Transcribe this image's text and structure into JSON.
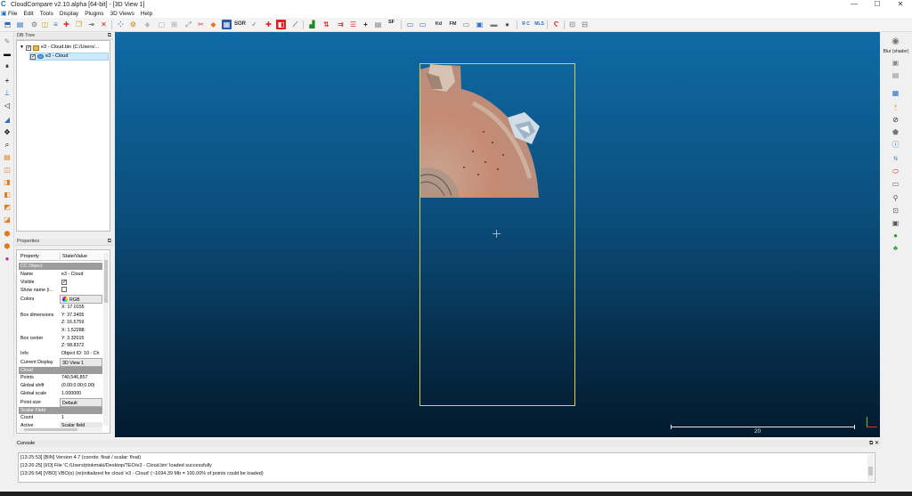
{
  "window": {
    "title": "CloudCompare v2.10.alpha [64-bit] - [3D View 1]",
    "controls": [
      "—",
      "☐",
      "✕"
    ]
  },
  "menu": [
    "File",
    "Edit",
    "Tools",
    "Display",
    "Plugins",
    "3D Views",
    "Help"
  ],
  "toolbar": {
    "sor_label": "SOR",
    "sf_label": "SF",
    "kd_label": "Kd",
    "fm_label": "FM",
    "rc_label": "R C",
    "mls_label": "MLS"
  },
  "db_tree": {
    "title": "DB Tree",
    "items": [
      {
        "label": "e3 - Cloud.bin (C:/Users/..."
      },
      {
        "label": "e3 - Cloud"
      }
    ]
  },
  "properties": {
    "title": "Properties",
    "col_property": "Property",
    "col_value": "State/Value",
    "sections": {
      "cc_object": "CC Object",
      "cloud": "Cloud",
      "scalar_field": "Scalar Field"
    },
    "rows": {
      "name_k": "Name",
      "name_v": "e3 - Cloud",
      "visible_k": "Visible",
      "visible_v": "✓",
      "showname_k": "Show name (i...",
      "showname_v": "",
      "colors_k": "Colors",
      "colors_v": "RGB",
      "boxdim_k": "Box dimensions",
      "boxdim_x": "X: 17.0155",
      "boxdim_y": "Y: 37.3405",
      "boxdim_z": "Z: 16.5759",
      "boxcenter_k": "Box center",
      "boxcenter_x": "X: 1.52288",
      "boxcenter_y": "Y: 3.32015",
      "boxcenter_z": "Z: 98.8372",
      "info_k": "Info",
      "info_v": "Object ID: 10 - Ch",
      "display_k": "Current Display",
      "display_v": "3D View 1",
      "points_k": "Points",
      "points_v": "740,546,857",
      "shift_k": "Global shift",
      "shift_v": "(0.00;0.00;0.00)",
      "scale_k": "Global scale",
      "scale_v": "1.000000",
      "psize_k": "Point size",
      "psize_v": "Default",
      "count_k": "Count",
      "count_v": "1",
      "active_k": "Active",
      "active_v": "Scalar field"
    }
  },
  "view3d": {
    "scale_value": "20"
  },
  "right_toolbar": {
    "blur_label": "Blur (shader)"
  },
  "console": {
    "title": "Console",
    "lines": [
      "[13:25:53] [BIN] Version 4.7 (coords: float / scalar: float)",
      "[13:26:25] [I/O] File 'C:/Users/ptokmaki/Desktop/TEO/e3 - Cloud.bin' loaded successfully",
      "[13:26:54] [VBO] VBO(s) (re)initialized for cloud 'e3 - Cloud' (~1694.39 Mb = 100.00% of points could be loaded)"
    ]
  },
  "colors": {
    "view_top": "#0f6aa5",
    "view_bottom": "#031a2d",
    "bbox": "#d9d04a",
    "accent": "#1a6fc4"
  }
}
